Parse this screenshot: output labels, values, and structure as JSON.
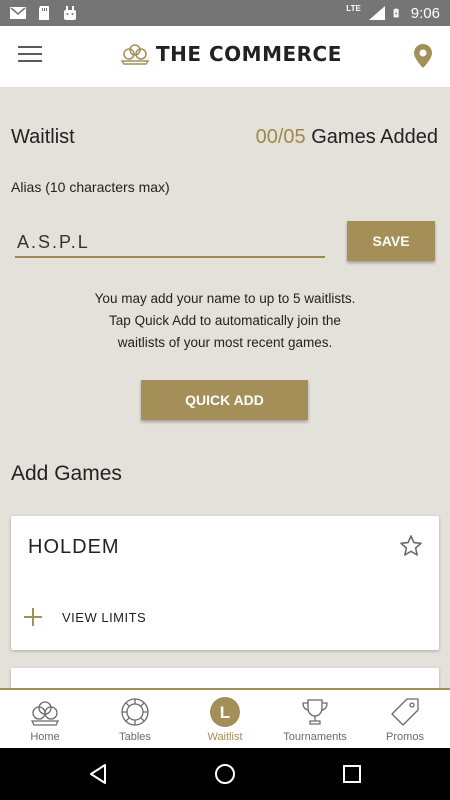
{
  "status_bar": {
    "time": "9:06",
    "network": "LTE"
  },
  "app_bar": {
    "title": "THE COMMERCE"
  },
  "waitlist": {
    "title": "Waitlist",
    "games_count": "00/05",
    "games_added_label": "Games Added",
    "alias_label": "Alias (10 characters max)",
    "alias_value": "A.S.P.L",
    "save_label": "SAVE",
    "info_line1": "You may add your name to up to 5 waitlists.",
    "info_line2": "Tap Quick Add to automatically join the",
    "info_line3": "waitlists of your most recent games.",
    "quick_add_label": "QUICK ADD"
  },
  "add_games": {
    "title": "Add Games",
    "games": [
      {
        "name": "HOLDEM",
        "view_limits_label": "VIEW LIMITS"
      }
    ]
  },
  "bottom_nav": {
    "items": [
      {
        "label": "Home",
        "icon": "crown-icon"
      },
      {
        "label": "Tables",
        "icon": "chip-icon"
      },
      {
        "label": "Waitlist",
        "icon": "waitlist-icon",
        "badge": "L"
      },
      {
        "label": "Tournaments",
        "icon": "trophy-icon"
      },
      {
        "label": "Promos",
        "icon": "tag-icon"
      }
    ],
    "active": "Waitlist"
  },
  "colors": {
    "accent": "#a58f58",
    "background": "#e4e1da",
    "status_bar": "#757575"
  }
}
